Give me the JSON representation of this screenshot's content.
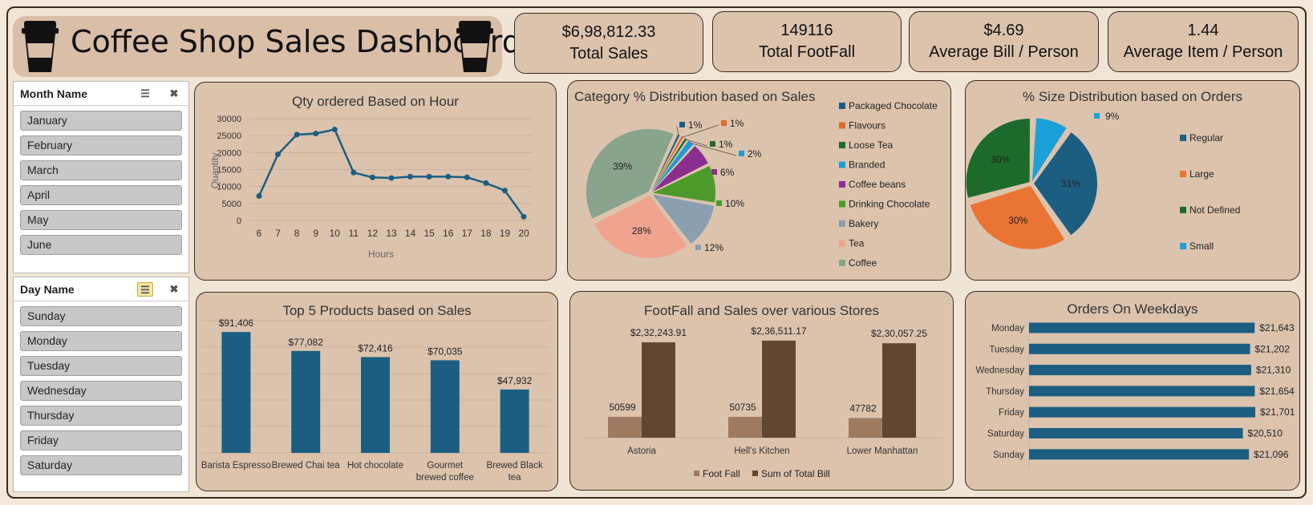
{
  "title": "Coffee Shop Sales Dashboard",
  "kpis": [
    {
      "value": "$6,98,812.33",
      "label": "Total Sales"
    },
    {
      "value": "149116",
      "label": "Total FootFall"
    },
    {
      "value": "$4.69",
      "label": "Average Bill / Person"
    },
    {
      "value": "1.44",
      "label": "Average Item / Person"
    }
  ],
  "month_slicer": {
    "header": "Month Name",
    "items": [
      "January",
      "February",
      "March",
      "April",
      "May",
      "June"
    ]
  },
  "day_slicer": {
    "header": "Day Name",
    "items": [
      "Sunday",
      "Monday",
      "Tuesday",
      "Wednesday",
      "Thursday",
      "Friday",
      "Saturday"
    ]
  },
  "colors": {
    "accent": "#1b5e82",
    "brown_dark": "#634631",
    "brown_light": "#9e7a60",
    "panel": "#dcc3ad"
  },
  "chart_data": [
    {
      "type": "line",
      "title": "Qty ordered Based on Hour",
      "xlabel": "Hours",
      "ylabel": "Quantity",
      "x": [
        6,
        7,
        8,
        9,
        10,
        11,
        12,
        13,
        14,
        15,
        16,
        17,
        18,
        19,
        20
      ],
      "values": [
        7200,
        19500,
        25300,
        25600,
        26800,
        14100,
        12700,
        12500,
        12900,
        12900,
        12900,
        12700,
        11000,
        8800,
        1100
      ],
      "ylim": [
        0,
        30000
      ],
      "yticks": [
        "0",
        "5000",
        "10000",
        "15000",
        "20000",
        "25000",
        "30000"
      ],
      "grid": true
    },
    {
      "type": "pie",
      "title": "Category % Distribution based on Sales",
      "legend": "right",
      "slices": [
        {
          "name": "Packaged Chocolate",
          "value": 1,
          "label": "1%",
          "color": "#1b5e82"
        },
        {
          "name": "Flavours",
          "value": 1,
          "label": "1%",
          "color": "#e06a2a"
        },
        {
          "name": "Loose Tea",
          "value": 1,
          "label": "1%",
          "color": "#1c6b2a"
        },
        {
          "name": "Branded",
          "value": 2,
          "label": "2%",
          "color": "#1b9bd6"
        },
        {
          "name": "Coffee beans",
          "value": 6,
          "label": "6%",
          "color": "#8b2f8f"
        },
        {
          "name": "Drinking Chocolate",
          "value": 10,
          "label": "10%",
          "color": "#4c9a2a"
        },
        {
          "name": "Bakery",
          "value": 12,
          "label": "12%",
          "color": "#8c9fb0"
        },
        {
          "name": "Tea",
          "value": 28,
          "label": "28%",
          "color": "#f0a48f"
        },
        {
          "name": "Coffee",
          "value": 39,
          "label": "39%",
          "color": "#89a38d"
        }
      ]
    },
    {
      "type": "pie",
      "title": "% Size Distribution based on Orders",
      "legend": "right",
      "slices": [
        {
          "name": "Regular",
          "value": 31,
          "label": "31%",
          "color": "#1b5e82"
        },
        {
          "name": "Large",
          "value": 30,
          "label": "30%",
          "color": "#ea7434"
        },
        {
          "name": "Not Defined",
          "value": 30,
          "label": "30%",
          "color": "#1c6b2a"
        },
        {
          "name": "Small",
          "value": 9,
          "label": "9%",
          "color": "#1ba1d9"
        }
      ]
    },
    {
      "type": "bar",
      "title": "Top 5 Products based on Sales",
      "categories": [
        "Barista Espresso",
        "Brewed Chai tea",
        "Hot chocolate",
        "Gourmet brewed coffee",
        "Brewed Black tea"
      ],
      "category_lines": [
        [
          "Barista Espresso"
        ],
        [
          "Brewed Chai tea"
        ],
        [
          "Hot chocolate"
        ],
        [
          "Gourmet",
          "brewed coffee"
        ],
        [
          "Brewed Black",
          "tea"
        ]
      ],
      "values": [
        91406,
        77082,
        72416,
        70035,
        47932
      ],
      "labels": [
        "$91,406",
        "$77,082",
        "$72,416",
        "$70,035",
        "$47,932"
      ],
      "ylim": [
        0,
        100000
      ],
      "grid": true
    },
    {
      "type": "bar",
      "title": "FootFall and Sales over various Stores",
      "categories": [
        "Astoria",
        "Hell's Kitchen",
        "Lower Manhattan"
      ],
      "series": [
        {
          "name": "Foot Fall",
          "values": [
            50599,
            50735,
            47782
          ],
          "labels": [
            "50599",
            "50735",
            "47782"
          ],
          "color": "#9e7a60"
        },
        {
          "name": "Sum of Total Bill",
          "values": [
            232243.91,
            236511.17,
            230057.25
          ],
          "labels": [
            "$2,32,243.91",
            "$2,36,511.17",
            "$2,30,057.25"
          ],
          "color": "#634631"
        }
      ],
      "legend": "bottom"
    },
    {
      "type": "bar",
      "orientation": "horizontal",
      "title": "Orders On Weekdays",
      "categories": [
        "Monday",
        "Tuesday",
        "Wednesday",
        "Thursday",
        "Friday",
        "Saturday",
        "Sunday"
      ],
      "values": [
        21643,
        21202,
        21310,
        21654,
        21701,
        20510,
        21096
      ],
      "labels": [
        "$21,643",
        "$21,202",
        "$21,310",
        "$21,654",
        "$21,701",
        "$20,510",
        "$21,096"
      ]
    }
  ]
}
